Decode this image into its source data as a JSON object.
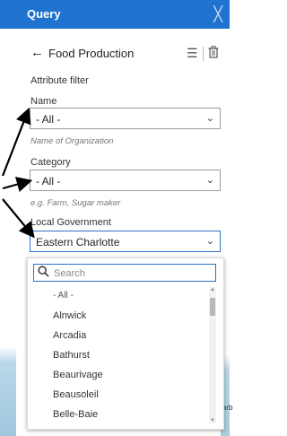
{
  "header": {
    "title": "Query",
    "close_glyph": "╳"
  },
  "panel": {
    "back_glyph": "←",
    "title": "Food Production",
    "list_icon": "list-icon",
    "trash_icon": "trash-icon",
    "section_label": "Attribute filter"
  },
  "filters": [
    {
      "label": "Name",
      "value": "- All -",
      "hint": "Name of Organization"
    },
    {
      "label": "Category",
      "value": "- All -",
      "hint": "e.g. Farm, Sugar maker"
    },
    {
      "label": "Local Government",
      "value": "Eastern Charlotte"
    }
  ],
  "dropdown": {
    "search_placeholder": "Search",
    "options": [
      "- All -",
      "Alnwick",
      "Arcadia",
      "Bathurst",
      "Beaurivage",
      "Beausoleil",
      "Belle-Baie"
    ]
  },
  "map": {
    "edge_text": "arb"
  },
  "colors": {
    "header_bg": "#1f73cf",
    "accent": "#2d70c9",
    "annotation_arrow": "#000000"
  }
}
